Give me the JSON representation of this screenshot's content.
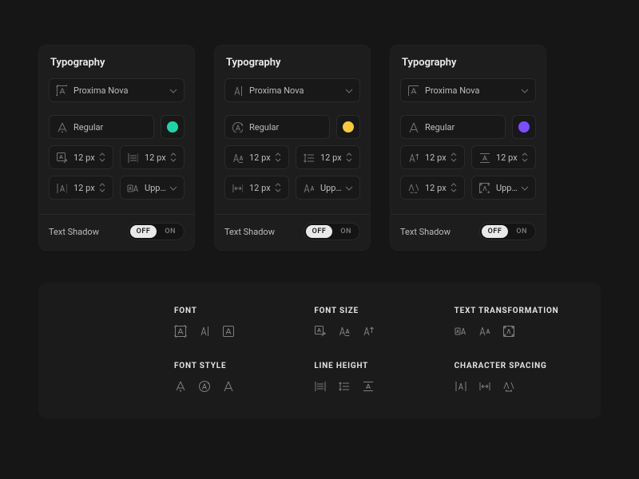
{
  "panels": [
    {
      "title": "Typography",
      "font": "Proxima Nova",
      "weight": "Regular",
      "swatch_color": "#1fd3a8",
      "font_size": "12 px",
      "line_height": "12 px",
      "spacing": "12 px",
      "transform": "Upperc..",
      "shadow_label": "Text Shadow",
      "shadow_off": "OFF",
      "shadow_on": "ON",
      "shadow_active": "off"
    },
    {
      "title": "Typography",
      "font": "Proxima Nova",
      "weight": "Regular",
      "swatch_color": "#f5c93a",
      "font_size": "12 px",
      "line_height": "12 px",
      "spacing": "12 px",
      "transform": "Upperc..",
      "shadow_label": "Text Shadow",
      "shadow_off": "OFF",
      "shadow_on": "ON",
      "shadow_active": "off"
    },
    {
      "title": "Typography",
      "font": "Proxima Nova",
      "weight": "Regular",
      "swatch_color": "#7c4dff",
      "font_size": "12 px",
      "line_height": "12 px",
      "spacing": "12 px",
      "transform": "Upperc..",
      "shadow_label": "Text Shadow",
      "shadow_off": "OFF",
      "shadow_on": "ON",
      "shadow_active": "off"
    }
  ],
  "legend": {
    "groups": [
      {
        "title": "FONT"
      },
      {
        "title": "FONT SIZE"
      },
      {
        "title": "TEXT TRANSFORMATION"
      },
      {
        "title": "FONT STYLE"
      },
      {
        "title": "LINE HEIGHT"
      },
      {
        "title": "CHARACTER SPACING"
      }
    ]
  }
}
